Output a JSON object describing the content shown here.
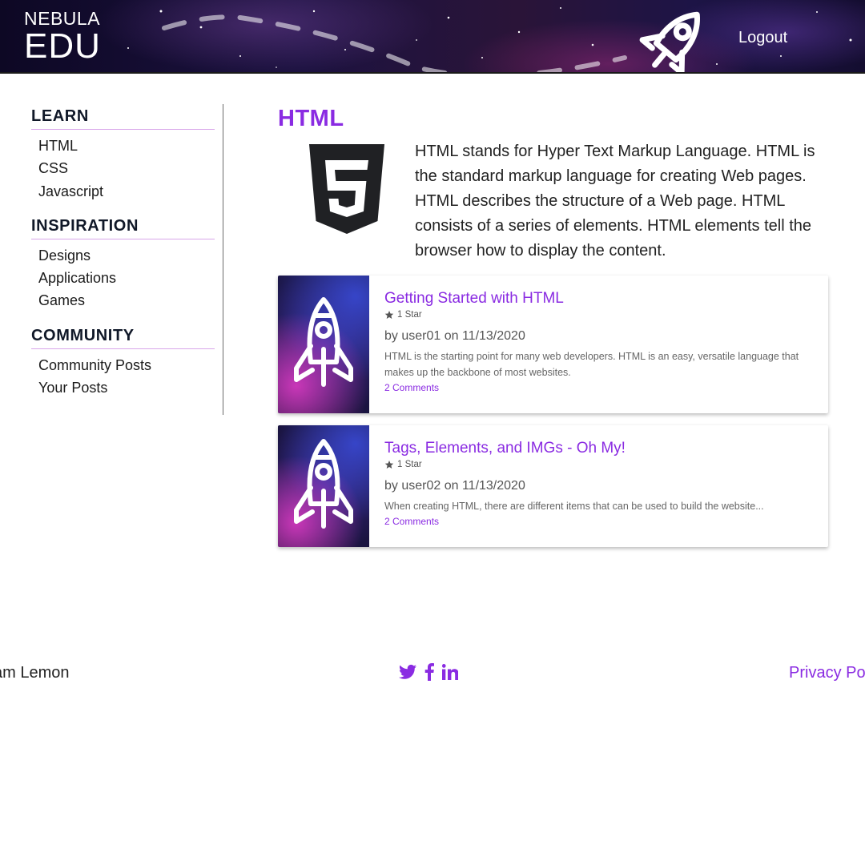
{
  "header": {
    "logo_top": "NEBULA",
    "logo_bottom": "EDU",
    "logout_label": "Logout"
  },
  "sidebar": {
    "sections": [
      {
        "heading": "LEARN",
        "items": [
          "HTML",
          "CSS",
          "Javascript"
        ]
      },
      {
        "heading": "INSPIRATION",
        "items": [
          "Designs",
          "Applications",
          "Games"
        ]
      },
      {
        "heading": "COMMUNITY",
        "items": [
          "Community Posts",
          "Your Posts"
        ]
      }
    ]
  },
  "main": {
    "title": "HTML",
    "intro": "HTML stands for Hyper Text Markup Language. HTML is the standard markup language for creating Web pages. HTML describes the structure of a Web page. HTML consists of a series of elements. HTML elements tell the browser how to display the content.",
    "posts": [
      {
        "title": "Getting Started with HTML",
        "rating": "1 Star",
        "byline": "by user01 on 11/13/2020",
        "excerpt": "HTML is the starting point for many web developers. HTML is an easy, versatile language that makes up the backbone of most websites.",
        "comments": "2 Comments"
      },
      {
        "title": "Tags, Elements, and IMGs - Oh My!",
        "rating": "1 Star",
        "byline": "by user02 on 11/13/2020",
        "excerpt": "When creating HTML, there are different items that can be used to build the website...",
        "comments": "2 Comments"
      }
    ]
  },
  "footer": {
    "left_text": "am Lemon",
    "right_link": "Privacy Po",
    "social_icons": [
      "twitter-icon",
      "facebook-icon",
      "linkedin-icon"
    ]
  },
  "colors": {
    "accent": "#8a2be2",
    "heading": "#101828",
    "divider": "#d9a6ea"
  }
}
